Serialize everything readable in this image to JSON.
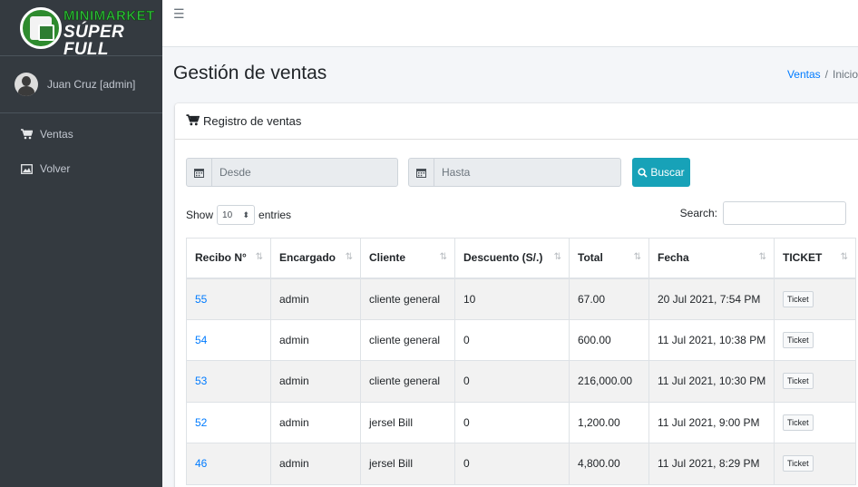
{
  "brand": {
    "line1": "MINIMARKET",
    "line2": "SÚPER FULL"
  },
  "user": {
    "name": "Juan Cruz [admin]"
  },
  "sidebar": {
    "items": [
      {
        "label": "Ventas",
        "icon": "shopping-cart-icon"
      },
      {
        "label": "Volver",
        "icon": "image-icon"
      }
    ]
  },
  "topbar": {
    "menu_icon": "hamburger-icon"
  },
  "header": {
    "title": "Gestión de ventas",
    "breadcrumb": {
      "link": "Ventas",
      "separator": "/",
      "current": "Inicio"
    }
  },
  "card": {
    "title": "Registro de ventas"
  },
  "filters": {
    "desde_placeholder": "Desde",
    "hasta_placeholder": "Hasta",
    "buscar_label": "Buscar"
  },
  "datatable": {
    "show_label": "Show",
    "entries_value": "10",
    "entries_label": "entries",
    "search_label": "Search:"
  },
  "table": {
    "columns": [
      "Recibo N°",
      "Encargado",
      "Cliente",
      "Descuento (S/.)",
      "Total",
      "Fecha",
      "TICKET"
    ],
    "rows": [
      {
        "recibo": "55",
        "encargado": "admin",
        "cliente": "cliente general",
        "descuento": "10",
        "total": "67.00",
        "fecha": "20 Jul 2021, 7:54 PM",
        "ticket": "Ticket"
      },
      {
        "recibo": "54",
        "encargado": "admin",
        "cliente": "cliente general",
        "descuento": "0",
        "total": "600.00",
        "fecha": "11 Jul 2021, 10:38 PM",
        "ticket": "Ticket"
      },
      {
        "recibo": "53",
        "encargado": "admin",
        "cliente": "cliente general",
        "descuento": "0",
        "total": "216,000.00",
        "fecha": "11 Jul 2021, 10:30 PM",
        "ticket": "Ticket"
      },
      {
        "recibo": "52",
        "encargado": "admin",
        "cliente": "jersel Bill",
        "descuento": "0",
        "total": "1,200.00",
        "fecha": "11 Jul 2021, 9:00 PM",
        "ticket": "Ticket"
      },
      {
        "recibo": "46",
        "encargado": "admin",
        "cliente": "jersel Bill",
        "descuento": "0",
        "total": "4,800.00",
        "fecha": "11 Jul 2021, 8:29 PM",
        "ticket": "Ticket"
      }
    ]
  },
  "colors": {
    "sidebar_bg": "#343a40",
    "link": "#007bff",
    "button_info": "#17a2b8",
    "brand_green": "#2fbf3a"
  }
}
